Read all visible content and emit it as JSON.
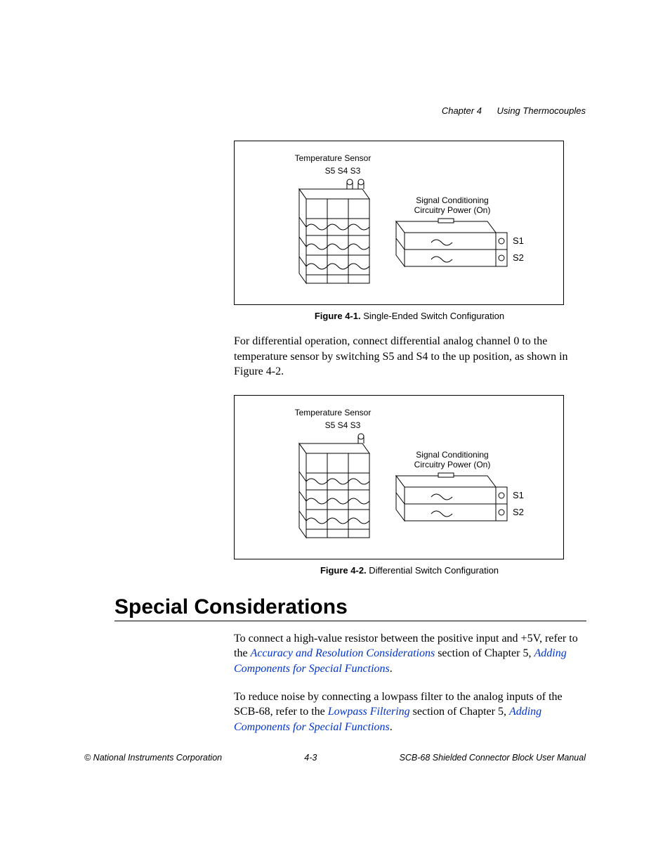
{
  "header": {
    "chapter": "Chapter 4",
    "title": "Using Thermocouples"
  },
  "figure1": {
    "temp_sensor_label": "Temperature Sensor",
    "switch_labels": "S5  S4 S3",
    "sig_cond_line1": "Signal Conditioning",
    "sig_cond_line2": "Circuitry Power (On)",
    "s1": "S1",
    "s2": "S2",
    "caption_label": "Figure 4-1.",
    "caption_text": "  Single-Ended Switch Configuration"
  },
  "paragraph1": "For differential operation, connect differential analog channel 0 to the temperature sensor by switching S5 and S4 to the up position, as shown in Figure 4-2.",
  "figure2": {
    "temp_sensor_label": "Temperature Sensor",
    "switch_labels": "S5  S4 S3",
    "sig_cond_line1": "Signal Conditioning",
    "sig_cond_line2": "Circuitry Power (On)",
    "s1": "S1",
    "s2": "S2",
    "caption_label": "Figure 4-2.",
    "caption_text": "  Differential Switch Configuration"
  },
  "section_heading": "Special Considerations",
  "paragraph2": {
    "pre": "To connect a high-value resistor between the positive input and +5V, refer to the ",
    "link1": "Accuracy and Resolution Considerations",
    "mid": " section of Chapter 5, ",
    "link2": "Adding Components for  Special  Functions",
    "post": "."
  },
  "paragraph3": {
    "pre": "To reduce noise by connecting a lowpass filter to the analog inputs of the SCB-68, refer to the ",
    "link1": "Lowpass Filtering",
    "mid": " section of Chapter 5, ",
    "link2": "Adding Components for  Special  Functions",
    "post": "."
  },
  "footer": {
    "left": "© National Instruments Corporation",
    "center": "4-3",
    "right": "SCB-68 Shielded Connector Block User Manual"
  }
}
